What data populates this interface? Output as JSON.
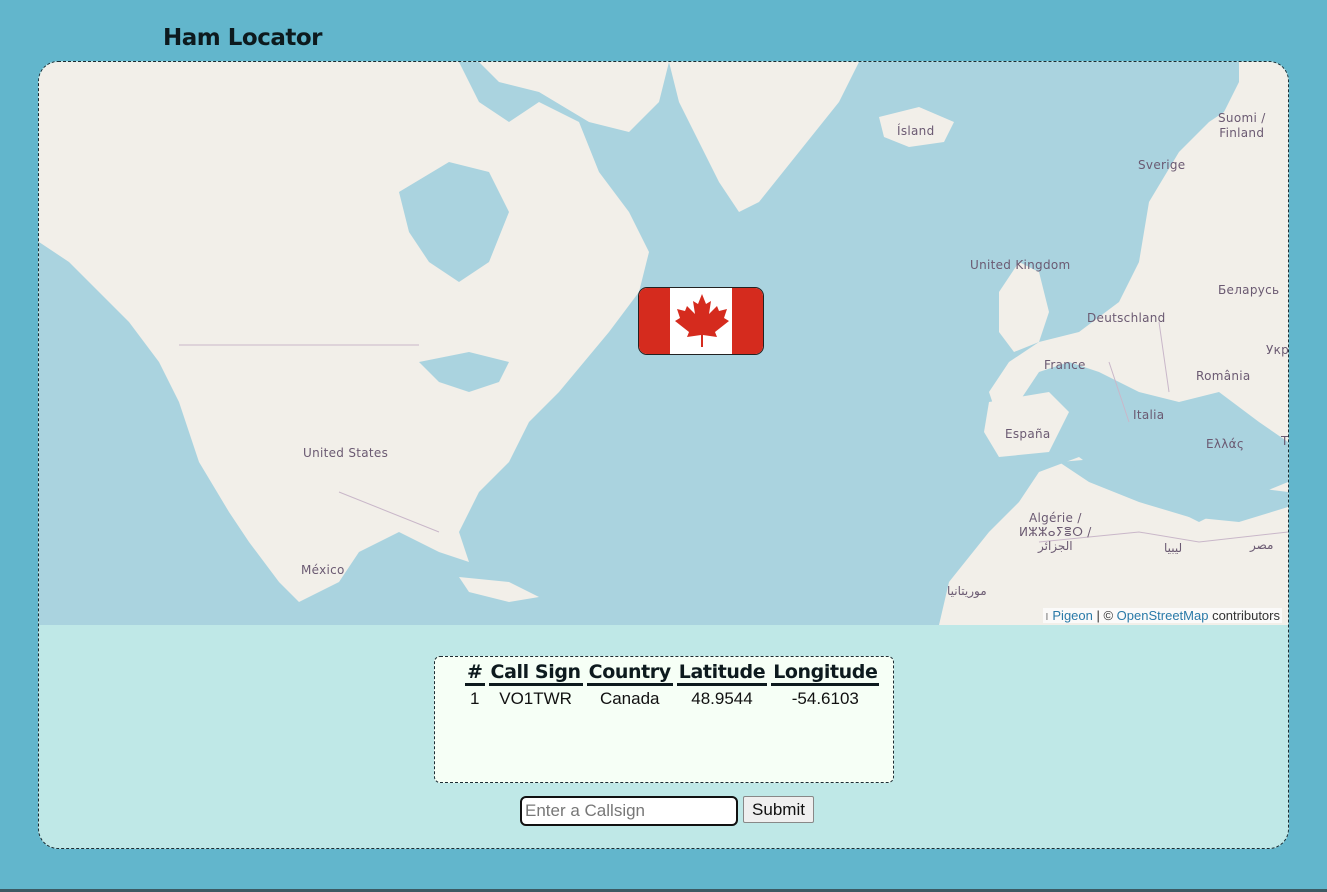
{
  "app": {
    "title": "Ham Locator"
  },
  "map": {
    "labels": {
      "island": "Ísland",
      "suomi_finland": "Suomi /\nFinland",
      "sverige": "Sverige",
      "united_kingdom": "United Kingdom",
      "belarus": "Беларусь",
      "deutschland": "Deutschland",
      "ukraine": "Укр",
      "france": "France",
      "romania": "România",
      "italia": "Italia",
      "espana": "España",
      "ellas": "Ελλάς",
      "turkey": "T",
      "united_states": "United States",
      "mexico": "México",
      "algerie": "Algérie /\nⵍⵣⵣⴰⵢⴻⵔ /\nالجزائر",
      "libya": "ليبيا",
      "egypt": "مصر",
      "mauritania": "موريتانيا"
    },
    "attribution": {
      "leaflet_link": "Pigeon",
      "separator": " | © ",
      "osm_link": "OpenStreetMap",
      "suffix": " contributors"
    },
    "marker": {
      "icon": "canada-flag-icon",
      "country": "Canada"
    }
  },
  "colors": {
    "background": "#62b6cc",
    "water": "#aad3df",
    "land": "#f2efe9",
    "panel": "#bfe8e7",
    "flag_red": "#d52b1e"
  },
  "results": {
    "headers": [
      "#",
      "Call Sign",
      "Country",
      "Latitude",
      "Longitude"
    ],
    "rows": [
      [
        "1",
        "VO1TWR",
        "Canada",
        "48.9544",
        "-54.6103"
      ]
    ]
  },
  "form": {
    "callsign_placeholder": "Enter a Callsign",
    "callsign_value": "",
    "submit_label": "Submit"
  }
}
